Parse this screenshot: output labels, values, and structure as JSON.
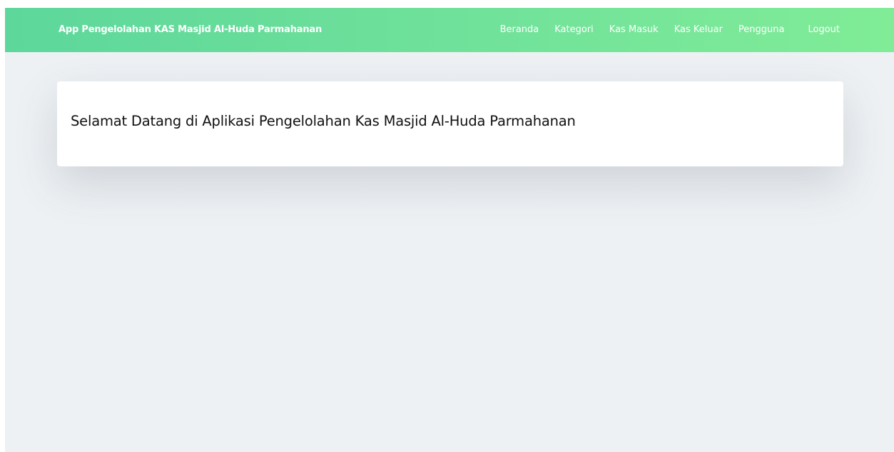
{
  "navbar": {
    "brand": "App Pengelolahan KAS Masjid Al-Huda Parmahanan",
    "links": [
      {
        "label": "Beranda"
      },
      {
        "label": "Kategori"
      },
      {
        "label": "Kas Masuk"
      },
      {
        "label": "Kas Keluar"
      },
      {
        "label": "Pengguna"
      },
      {
        "label": "Logout"
      }
    ]
  },
  "main": {
    "welcome_title": "Selamat Datang di Aplikasi Pengelolahan Kas Masjid Al-Huda Parmahanan"
  },
  "colors": {
    "navbar_start": "#5dd79b",
    "navbar_end": "#80ec97",
    "page_background": "#edf1f4",
    "card_background": "#ffffff"
  }
}
